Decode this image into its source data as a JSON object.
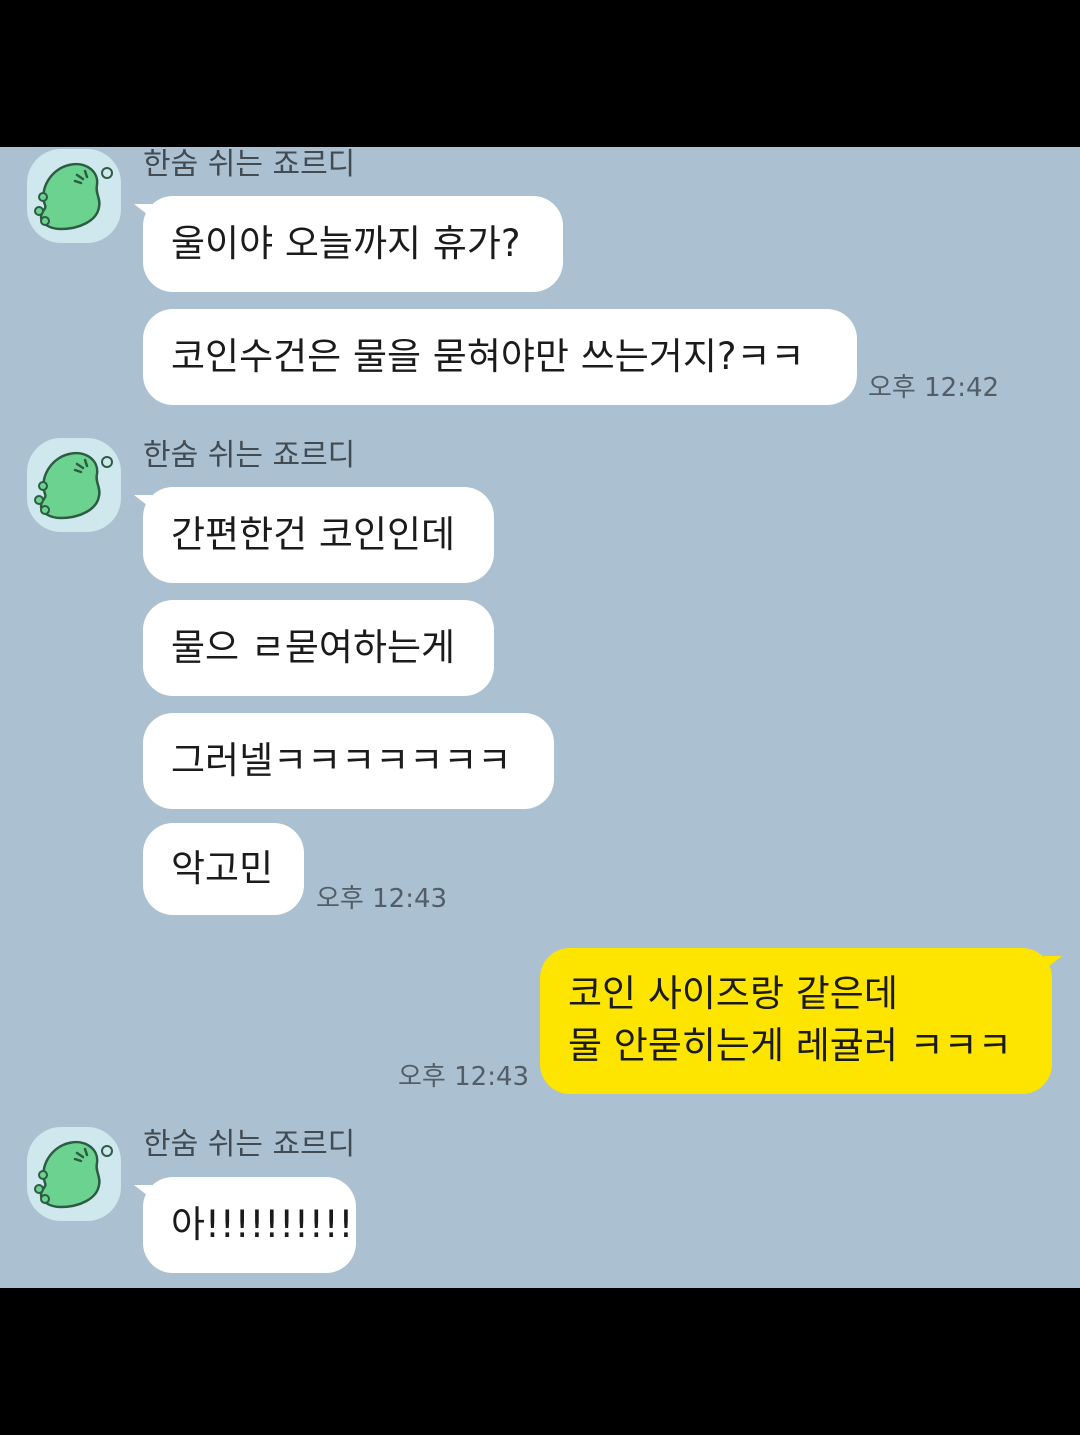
{
  "messages": {
    "group1": {
      "sender": "한숨 쉬는 죠르디",
      "bubbles": [
        "울이야 오늘까지 휴가?",
        "코인수건은 물을 묻혀야만 쓰는거지?ㅋㅋ"
      ],
      "time": "오후 12:42"
    },
    "group2": {
      "sender": "한숨 쉬는 죠르디",
      "bubbles": [
        "간편한건 코인인데",
        "물으 ㄹ묻여하는게",
        "그러넬ㅋㅋㅋㅋㅋㅋㅋ",
        "악고민"
      ],
      "time": "오후 12:43"
    },
    "mine": {
      "lines": [
        "코인 사이즈랑 같은데",
        "물 안묻히는게 레귤러 ㅋㅋㅋ"
      ],
      "time": "오후 12:43"
    },
    "group3": {
      "sender": "한숨 쉬는 죠르디",
      "bubbles": [
        "아!!!!!!!!!!"
      ]
    }
  },
  "colors": {
    "chat_background": "#abc1d1",
    "my_bubble": "#fee500",
    "their_bubble": "#ffffff",
    "avatar_background": "#cfe8ee",
    "avatar_character": "#6bd38f"
  },
  "icons": {
    "avatar": "jordy-dinosaur-icon"
  }
}
